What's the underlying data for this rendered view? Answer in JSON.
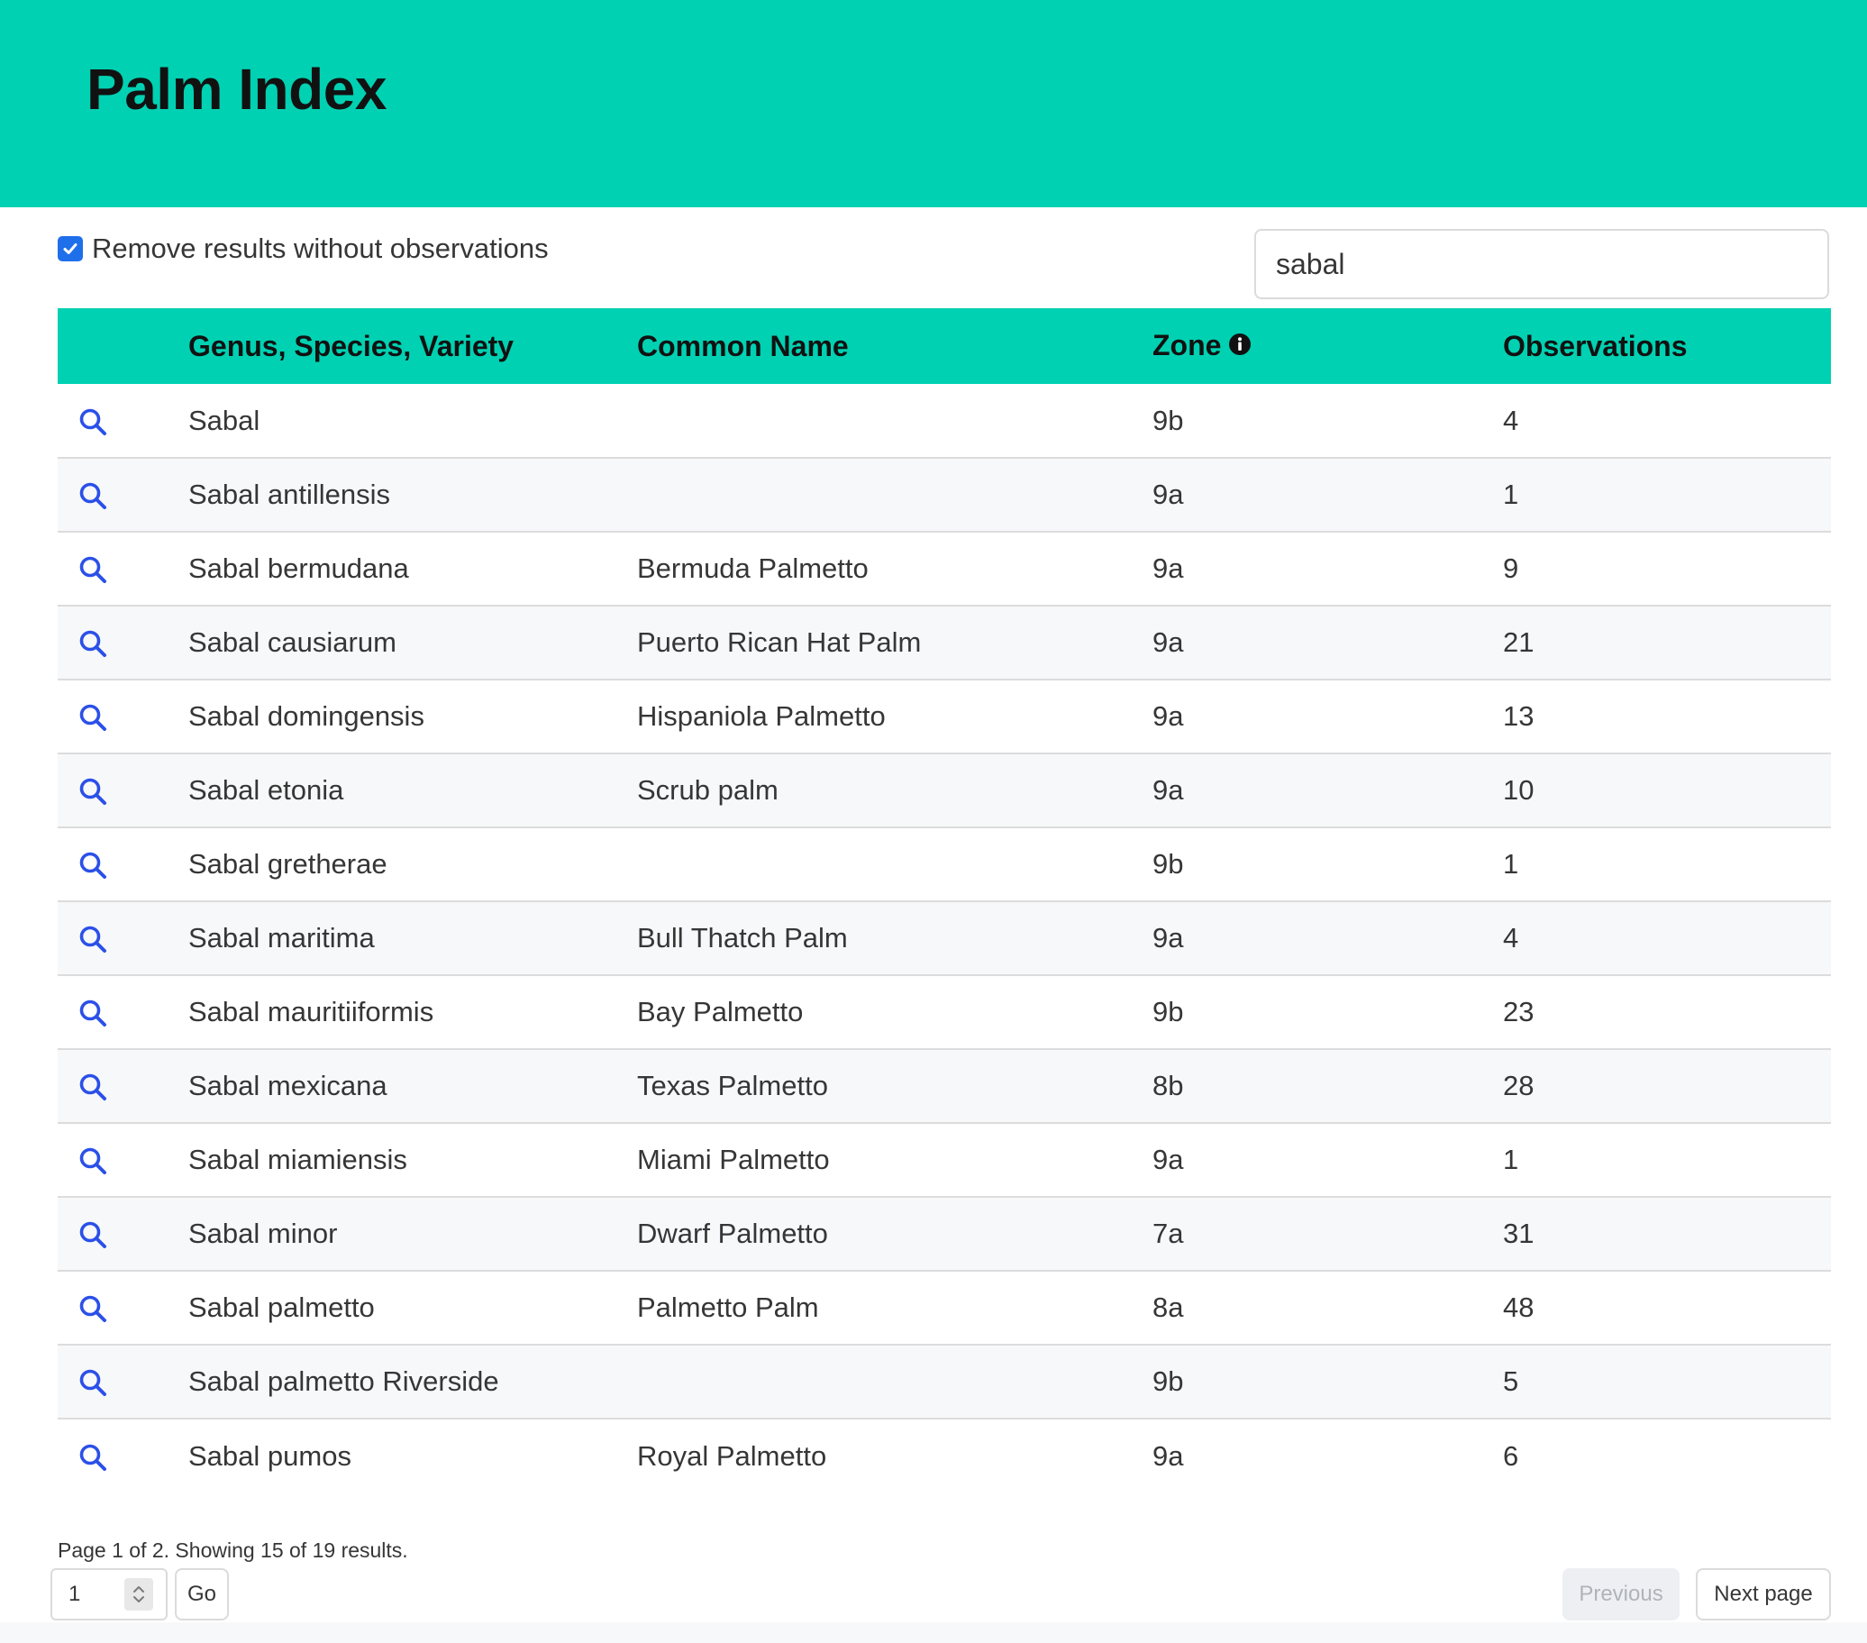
{
  "header": {
    "title": "Palm Index"
  },
  "filter": {
    "checkbox_label": "Remove results without observations",
    "checked": true
  },
  "search": {
    "value": "sabal"
  },
  "table": {
    "columns": [
      "Genus, Species, Variety",
      "Common Name",
      "Zone",
      "Observations"
    ],
    "rows": [
      {
        "genus": "Sabal",
        "common": "",
        "zone": "9b",
        "obs": "4"
      },
      {
        "genus": "Sabal antillensis",
        "common": "",
        "zone": "9a",
        "obs": "1"
      },
      {
        "genus": "Sabal bermudana",
        "common": "Bermuda Palmetto",
        "zone": "9a",
        "obs": "9"
      },
      {
        "genus": "Sabal causiarum",
        "common": "Puerto Rican Hat Palm",
        "zone": "9a",
        "obs": "21"
      },
      {
        "genus": "Sabal domingensis",
        "common": "Hispaniola Palmetto",
        "zone": "9a",
        "obs": "13"
      },
      {
        "genus": "Sabal etonia",
        "common": "Scrub palm",
        "zone": "9a",
        "obs": "10"
      },
      {
        "genus": "Sabal gretherae",
        "common": "",
        "zone": "9b",
        "obs": "1"
      },
      {
        "genus": "Sabal maritima",
        "common": "Bull Thatch Palm",
        "zone": "9a",
        "obs": "4"
      },
      {
        "genus": "Sabal mauritiiformis",
        "common": "Bay Palmetto",
        "zone": "9b",
        "obs": "23"
      },
      {
        "genus": "Sabal mexicana",
        "common": "Texas Palmetto",
        "zone": "8b",
        "obs": "28"
      },
      {
        "genus": "Sabal miamiensis",
        "common": "Miami Palmetto",
        "zone": "9a",
        "obs": "1"
      },
      {
        "genus": "Sabal minor",
        "common": "Dwarf Palmetto",
        "zone": "7a",
        "obs": "31"
      },
      {
        "genus": "Sabal palmetto",
        "common": "Palmetto Palm",
        "zone": "8a",
        "obs": "48"
      },
      {
        "genus": "Sabal palmetto Riverside",
        "common": "",
        "zone": "9b",
        "obs": "5"
      },
      {
        "genus": "Sabal pumos",
        "common": "Royal Palmetto",
        "zone": "9a",
        "obs": "6"
      }
    ]
  },
  "pagination": {
    "summary": "Page 1 of 2. Showing 15 of 19 results.",
    "page_value": "1",
    "go_label": "Go",
    "previous_label": "Previous",
    "next_label": "Next page"
  },
  "colors": {
    "brand": "#00d1b2",
    "link_icon": "#2b50e8",
    "disabled_text": "#b0b4b9"
  },
  "icons": {
    "row_action": "search-icon",
    "zone_info": "info-icon",
    "checkbox": "checkmark-icon",
    "stepper": "chevron-updown-icon"
  }
}
